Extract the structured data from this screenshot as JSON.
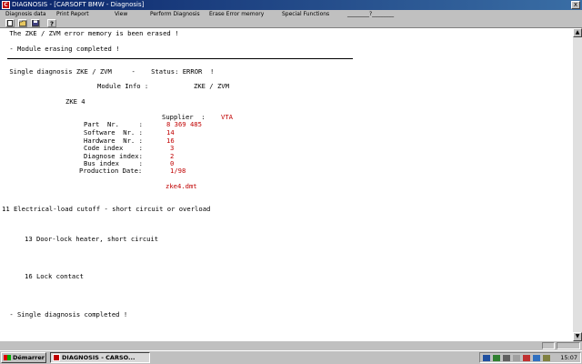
{
  "window": {
    "title": "DIAGNOSIS - [CARSOFT BMW - Diagnosis]",
    "close_glyph": "x"
  },
  "menu": {
    "items": [
      "Diagnosis data",
      "Print Report",
      "View",
      "Perform Diagnosis",
      "Erase Error memory",
      "Special Functions",
      "________?________"
    ]
  },
  "toolbar": {
    "new_icon": "document-icon",
    "open_icon": "folder-icon",
    "save_icon": "disk-icon",
    "help_icon": "help-icon"
  },
  "content": {
    "line1": " The ZKE / ZVM error memory is been erased !",
    "line2": " - Module erasing completed !",
    "diag_header": " Single diagnosis ZKE / ZVM     -    Status: ERROR  !",
    "module_info_label": "Module Info :",
    "module_info_value": "ZKE / ZVM",
    "module_name": "ZKE 4",
    "supplier_label": "Supplier  :",
    "supplier_value": "VTA",
    "part_label": "Part  Nr.     :",
    "part_value": "8 369 485",
    "software_label": "Software  Nr. :",
    "software_value": "14",
    "hardware_label": "Hardware  Nr. :",
    "hardware_value": "16",
    "code_label": "Code index    :",
    "code_value": "3",
    "diag_index_label": "Diagnose index:",
    "diag_index_value": "2",
    "bus_label": "Bus index     :",
    "bus_value": "0",
    "prod_label": "Production Date:",
    "prod_value": "1/98",
    "file_name": "zke4.dmt",
    "error1": "11 Electrical-load cutoff - short circuit or overload",
    "error2": "13 Door-lock heater, short circuit",
    "error3": "16 Lock contact",
    "final": " - Single diagnosis completed !"
  },
  "scrollbar": {
    "up": "▲",
    "down": "▼"
  },
  "taskbar": {
    "start_label": "Démarrer",
    "task_label": "DIAGNOSIS - CARSO...",
    "clock": "15:07"
  },
  "colors": {
    "accent_red": "#c00000",
    "titlebar": "#0a246a"
  }
}
